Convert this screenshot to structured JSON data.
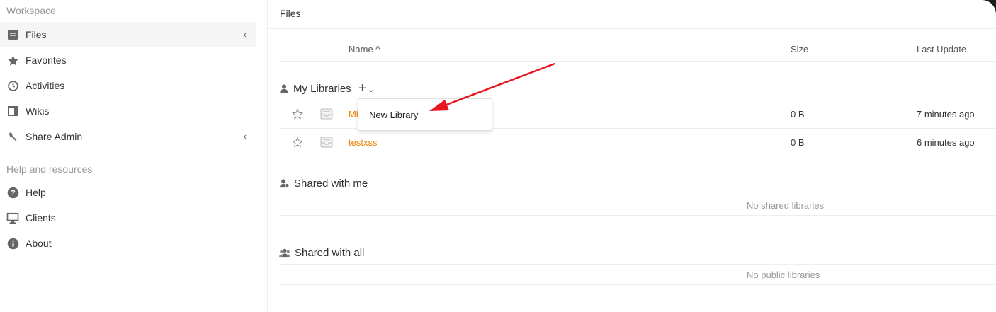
{
  "sidebar": {
    "workspace_heading": "Workspace",
    "items": [
      {
        "label": "Files",
        "icon": "file-icon",
        "active": true,
        "chevron": "‹"
      },
      {
        "label": "Favorites",
        "icon": "star-icon"
      },
      {
        "label": "Activities",
        "icon": "clock-icon"
      },
      {
        "label": "Wikis",
        "icon": "wiki-icon"
      },
      {
        "label": "Share Admin",
        "icon": "wrench-icon",
        "chevron": "‹"
      }
    ],
    "help_heading": "Help and resources",
    "help_items": [
      {
        "label": "Help",
        "icon": "question-icon"
      },
      {
        "label": "Clients",
        "icon": "monitor-icon"
      },
      {
        "label": "About",
        "icon": "info-icon"
      }
    ]
  },
  "main": {
    "path_title": "Files",
    "columns": {
      "name": "Name ^",
      "size": "Size",
      "last_update": "Last Update"
    },
    "my_libraries": {
      "heading": "My Libraries",
      "add_symbol": "+",
      "caret": "⌄",
      "rows": [
        {
          "name": "Mi",
          "size": "0 B",
          "updated": "7 minutes ago"
        },
        {
          "name": "testxss",
          "size": "0 B",
          "updated": "6 minutes ago"
        }
      ]
    },
    "shared_with_me": {
      "heading": "Shared with me",
      "empty_text": "No shared libraries"
    },
    "shared_with_all": {
      "heading": "Shared with all",
      "empty_text": "No public libraries"
    },
    "dropdown": {
      "item": "New Library"
    }
  },
  "colors": {
    "accent_orange": "#eb8205",
    "annotation_arrow": "#e8141e"
  }
}
